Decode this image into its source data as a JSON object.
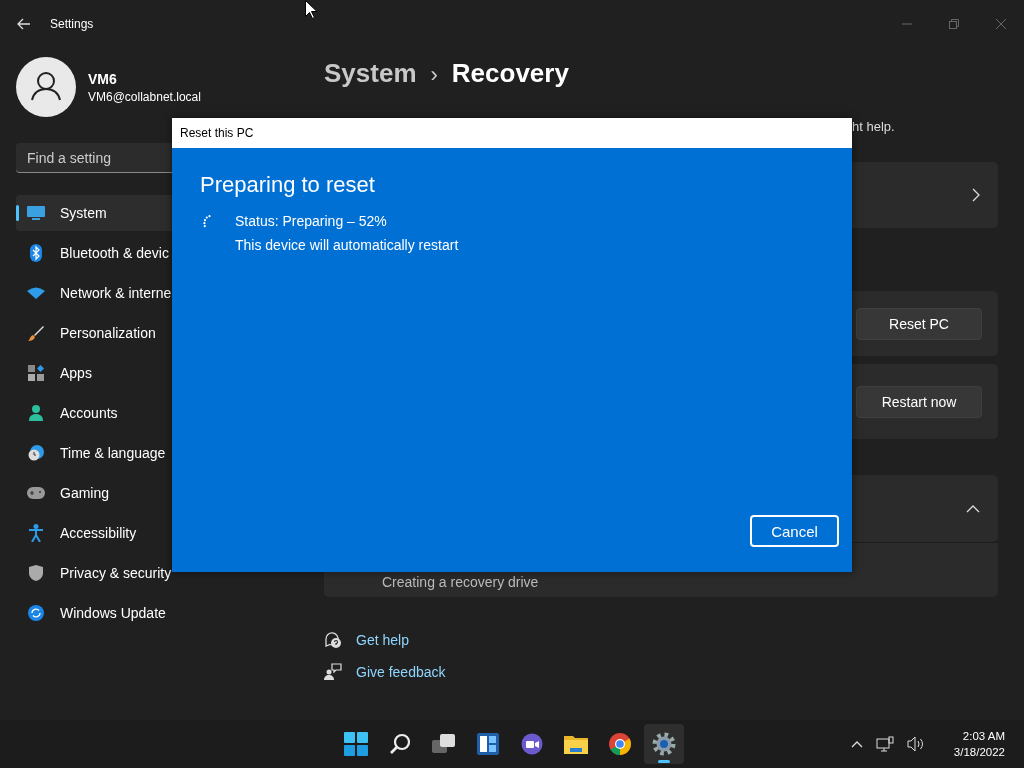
{
  "window": {
    "title": "Settings"
  },
  "profile": {
    "name": "VM6",
    "email": "VM6@collabnet.local"
  },
  "search": {
    "placeholder": "Find a setting"
  },
  "sidebar": {
    "items": [
      {
        "label": "System",
        "selected": true
      },
      {
        "label": "Bluetooth & devic",
        "selected": false
      },
      {
        "label": "Network & interne",
        "selected": false
      },
      {
        "label": "Personalization",
        "selected": false
      },
      {
        "label": "Apps",
        "selected": false
      },
      {
        "label": "Accounts",
        "selected": false
      },
      {
        "label": "Time & language",
        "selected": false
      },
      {
        "label": "Gaming",
        "selected": false
      },
      {
        "label": "Accessibility",
        "selected": false
      },
      {
        "label": "Privacy & security",
        "selected": false
      },
      {
        "label": "Windows Update",
        "selected": false
      }
    ]
  },
  "breadcrumb": {
    "parent": "System",
    "separator": "›",
    "current": "Recovery"
  },
  "intro": {
    "end": "ht help."
  },
  "cards": [
    {
      "kind": "link"
    },
    {
      "kind": "button",
      "button": "Reset PC"
    },
    {
      "kind": "button",
      "button": "Restart now"
    },
    {
      "kind": "expander",
      "expanded": true,
      "detail": "Creating a recovery drive"
    }
  ],
  "links": [
    {
      "label": "Get help"
    },
    {
      "label": "Give feedback"
    }
  ],
  "dialog": {
    "title": "Reset this PC",
    "heading": "Preparing to reset",
    "status": "Status: Preparing – 52%",
    "note": "This device will automatically restart",
    "button": "Cancel"
  },
  "taskbar": {
    "apps": [
      {
        "selected": false
      },
      {
        "selected": false
      },
      {
        "selected": false
      },
      {
        "selected": false
      },
      {
        "selected": false
      },
      {
        "selected": false
      },
      {
        "selected": false
      },
      {
        "selected": true
      }
    ],
    "time": "2:03 AM",
    "date": "3/18/2022"
  }
}
